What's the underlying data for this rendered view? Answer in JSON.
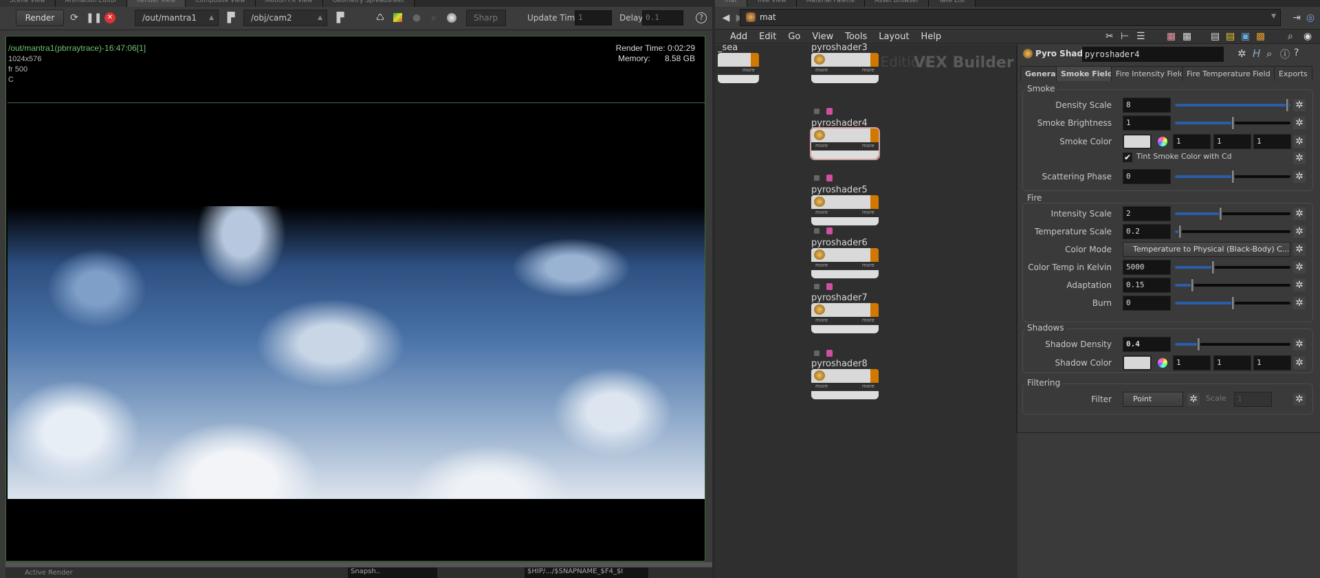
{
  "left_tabs": [
    "Scene View",
    "Animation Editor",
    "Render View",
    "Composite View",
    "Motion FX View",
    "Geometry Spreadsheet"
  ],
  "right_tabs": [
    "mat",
    "Tree View",
    "Material Palette",
    "Asset Browser",
    "Take List"
  ],
  "render_toolbar": {
    "render_label": "Render",
    "rop": "/out/mantra1",
    "camera": "/obj/cam2",
    "preview_mode": "Sharp",
    "update_time_label": "Update Time",
    "update_time_value": "1",
    "delay_label": "Delay",
    "delay_value": "0.1",
    "help": "?"
  },
  "viewer": {
    "title": "/out/mantra1(pbrraytrace)-16:47:06[1]",
    "resolution": "1024x576",
    "frame": "fr 500",
    "channel": "C",
    "render_time": "Render Time: 0:02:29",
    "memory_label": "Memory:",
    "memory_value": "8.58 GB",
    "progress": 1.0
  },
  "bottom_bar": {
    "active_render": "Active Render",
    "snapshot_field": "Snapsh..",
    "path": "$HIP/.../$SNAPNAME_$F4_$I"
  },
  "network": {
    "path": "mat",
    "menu": [
      "Add",
      "Edit",
      "Go",
      "View",
      "Tools",
      "Layout",
      "Help"
    ],
    "watermark_edition": "Indie Edition",
    "watermark": "VEX Builder",
    "nodes": [
      {
        "name": "_sea"
      },
      {
        "name": "pyroshader3"
      },
      {
        "name": "pyroshader4",
        "selected": true
      },
      {
        "name": "pyroshader5"
      },
      {
        "name": "pyroshader6"
      },
      {
        "name": "pyroshader7"
      },
      {
        "name": "pyroshader8"
      }
    ],
    "port_label": "more"
  },
  "params": {
    "type": "Pyro Shader",
    "node_name": "pyroshader4",
    "tabs": [
      "General",
      "Smoke Field",
      "Fire Intensity Field",
      "Fire Temperature Field",
      "Exports"
    ],
    "active_tab": "Smoke Field",
    "smoke": {
      "label": "Smoke",
      "density_scale": {
        "label": "Density Scale",
        "value": "8",
        "slider": 1.0
      },
      "smoke_brightness": {
        "label": "Smoke Brightness",
        "value": "1",
        "slider": 0.5
      },
      "smoke_color": {
        "label": "Smoke Color",
        "r": "1",
        "g": "1",
        "b": "1"
      },
      "tint": {
        "label": "Tint Smoke Color with Cd",
        "checked": true
      },
      "scattering_phase": {
        "label": "Scattering Phase",
        "value": "0",
        "slider": 0.5
      }
    },
    "fire": {
      "label": "Fire",
      "intensity_scale": {
        "label": "Intensity Scale",
        "value": "2",
        "slider": 0.39
      },
      "temperature_scale": {
        "label": "Temperature Scale",
        "value": "0.2",
        "slider": 0.04
      },
      "color_mode": {
        "label": "Color Mode",
        "value": "Temperature to Physical (Black-Body) C..."
      },
      "color_temp": {
        "label": "Color Temp in Kelvin",
        "value": "5000",
        "slider": 0.33
      },
      "adaptation": {
        "label": "Adaptation",
        "value": "0.15",
        "slider": 0.15
      },
      "burn": {
        "label": "Burn",
        "value": "0",
        "slider": 0.5
      }
    },
    "shadows": {
      "label": "Shadows",
      "shadow_density": {
        "label": "Shadow Density",
        "value": "0.4",
        "slider": 0.2
      },
      "shadow_color": {
        "label": "Shadow Color",
        "r": "1",
        "g": "1",
        "b": "1"
      }
    },
    "filtering": {
      "label": "Filtering",
      "filter": {
        "label": "Filter",
        "value": "Point"
      },
      "scale": {
        "label": "Scale",
        "value": "1"
      }
    }
  }
}
